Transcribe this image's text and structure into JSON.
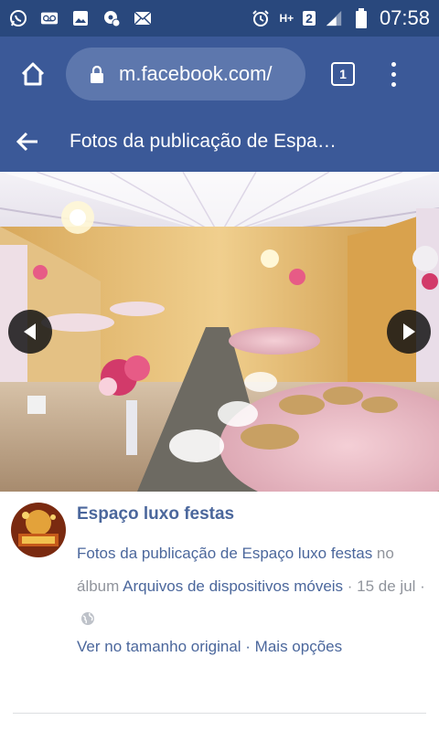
{
  "status_bar": {
    "time": "07:58",
    "network": "H+",
    "sim": "2",
    "icons": [
      "whatsapp-icon",
      "voicemail-icon",
      "image-icon",
      "settings-icon",
      "mail-icon",
      "alarm-icon",
      "signal-icon",
      "battery-icon"
    ]
  },
  "browser": {
    "url": "m.facebook.com/",
    "tab_count": "1"
  },
  "header": {
    "title": "Fotos da publicação de Espa…"
  },
  "post": {
    "page_name": "Espaço luxo festas",
    "caption_prefix": "Fotos da publicação de Espaço luxo festas",
    "caption_no": " no ",
    "album_label": "álbum",
    "album_name": "Arquivos de dispositivos móveis",
    "date": " · 15 de jul · ",
    "view_original": "Ver no tamanho original",
    "separator": " · ",
    "more_options": "Mais opções"
  },
  "colors": {
    "status_bar": "#29487d",
    "header": "#3b5998",
    "url_pill": "#5d77ad",
    "link": "#4b679c",
    "muted_text": "#90949c"
  }
}
